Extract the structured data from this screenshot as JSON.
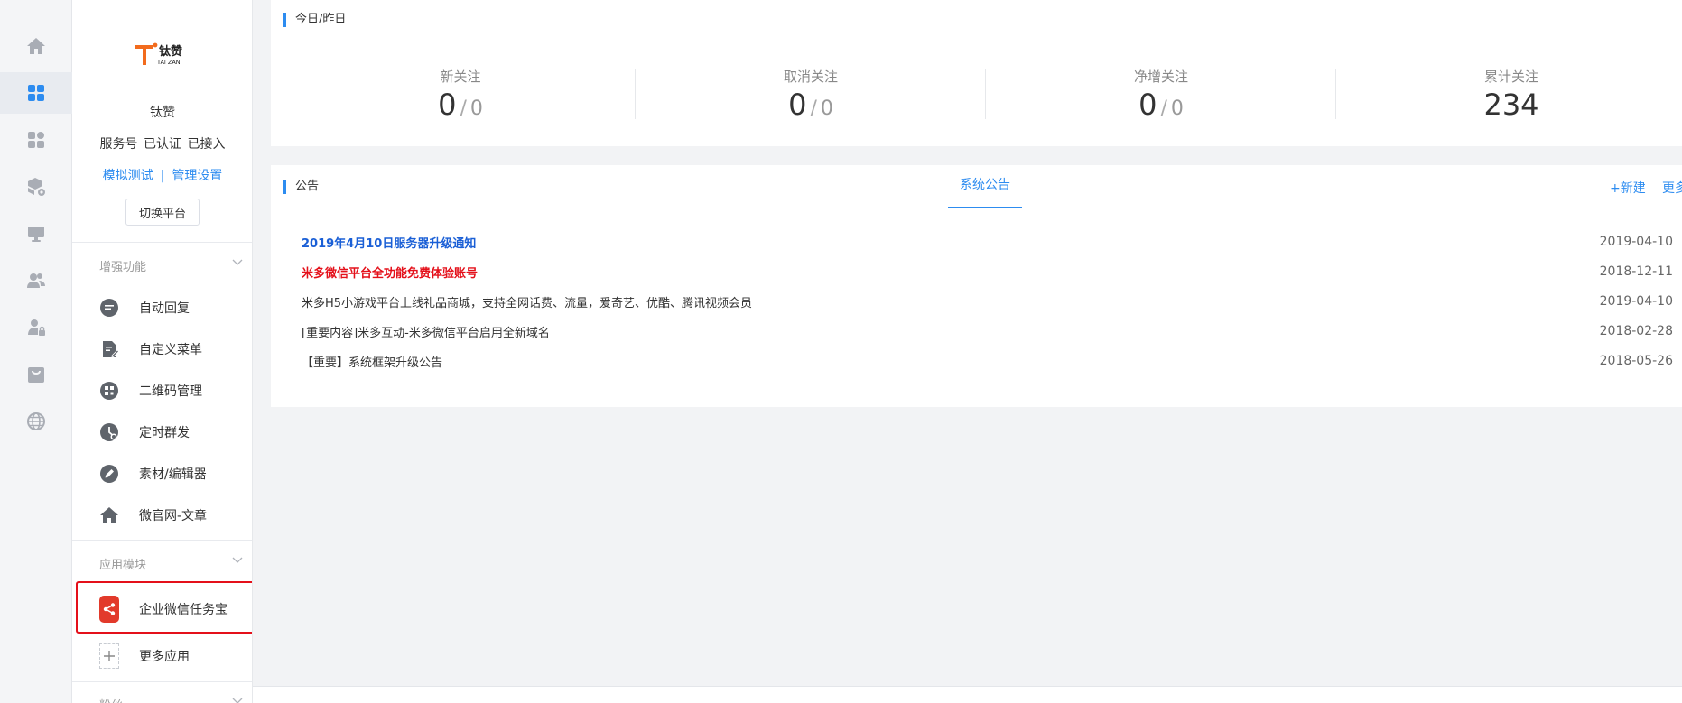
{
  "account": {
    "logo_main": "钛赞",
    "logo_sub": "TAI ZAN",
    "name": "钛赞",
    "status": "服务号 已认证 已接入",
    "link_test": "模拟测试",
    "link_sep": "|",
    "link_manage": "管理设置",
    "switch_label": "切换平台"
  },
  "rail": {
    "icons": [
      "home-icon",
      "dashboard-icon",
      "apps-icon",
      "package-settings-icon",
      "monitor-icon",
      "users-icon",
      "user-lock-icon",
      "shop-icon",
      "globe-icon"
    ],
    "active_index": 1,
    "icon_color": "#a9adb5",
    "active_color": "#2d8cf0"
  },
  "menu": {
    "enhance_title": "增强功能",
    "enhance_items": [
      {
        "label": "自动回复",
        "icon": "chat-icon"
      },
      {
        "label": "自定义菜单",
        "icon": "edit-document-icon"
      },
      {
        "label": "二维码管理",
        "icon": "qrcode-icon"
      },
      {
        "label": "定时群发",
        "icon": "clock-icon"
      },
      {
        "label": "素材/编辑器",
        "icon": "pen-icon"
      },
      {
        "label": "微官网-文章",
        "icon": "home-icon"
      }
    ],
    "apps_title": "应用模块",
    "apps_items": [
      {
        "label": "企业微信任务宝",
        "icon": "share-icon",
        "highlighted": true
      },
      {
        "label": "更多应用",
        "icon": "plus-icon"
      }
    ],
    "next_section_title": "粉丝"
  },
  "stats": {
    "label": "今日/昨日",
    "items": [
      {
        "label": "新关注",
        "today": "0",
        "slash": "/",
        "yesterday": "0"
      },
      {
        "label": "取消关注",
        "today": "0",
        "slash": "/",
        "yesterday": "0"
      },
      {
        "label": "净增关注",
        "today": "0",
        "slash": "/",
        "yesterday": "0"
      },
      {
        "label": "累计关注",
        "total": "234"
      }
    ]
  },
  "notice": {
    "label": "公告",
    "tab": "系统公告",
    "new_link": "+新建",
    "more_link": "更多",
    "rows": [
      {
        "title": "2019年4月10日服务器升级通知",
        "date": "2019-04-10",
        "style": "blue"
      },
      {
        "title": "米多微信平台全功能免费体验账号",
        "date": "2018-12-11",
        "style": "red"
      },
      {
        "title": "米多H5小游戏平台上线礼品商城，支持全网话费、流量，爱奇艺、优酷、腾讯视频会员",
        "date": "2019-04-10",
        "style": "normal"
      },
      {
        "title": "[重要内容]米多互动-米多微信平台启用全新域名",
        "date": "2018-02-28",
        "style": "normal"
      },
      {
        "title": "【重要】系统框架升级公告",
        "date": "2018-05-26",
        "style": "normal"
      }
    ]
  },
  "colors": {
    "accent": "#2d8cf0",
    "highlight_border": "#e4101a",
    "app_red": "#e23a2b",
    "logo_orange": "#f26b1d"
  }
}
